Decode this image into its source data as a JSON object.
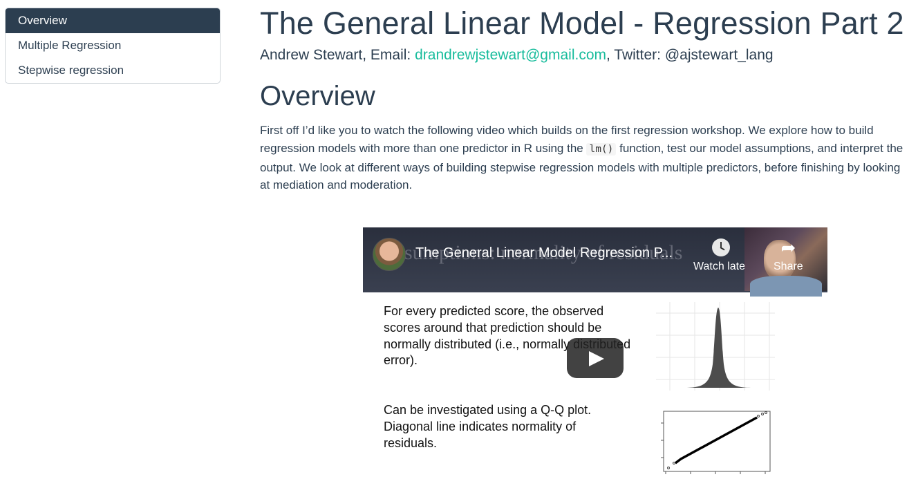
{
  "toc": {
    "items": [
      {
        "label": "Overview",
        "active": true
      },
      {
        "label": "Multiple Regression",
        "active": false
      },
      {
        "label": "Stepwise regression",
        "active": false
      }
    ]
  },
  "header": {
    "title": "The General Linear Model - Regression Part 2",
    "author_prefix": "Andrew Stewart, Email: ",
    "email": "drandrewjstewart@gmail.com",
    "author_suffix": ", Twitter: @ajstewart_lang"
  },
  "overview": {
    "heading": "Overview",
    "text_1": "First off I’d like you to watch the following video which builds on the first regression workshop. We explore how to build regression models with more than one predictor in R using the ",
    "code": "lm()",
    "text_2": " function, test our model assumptions, and interpret the output. We look at different ways of building stepwise regression models with multiple predictors, before finishing by looking at mediation and moderation."
  },
  "video": {
    "title": "The General Linear Model Regression P...",
    "background_title": "sumptions: normality of residuals",
    "watch_later_label": "Watch later",
    "share_label": "Share",
    "slide_text_1": "For every predicted score, the observed scores around that prediction should be normally distributed (i.e., normally distributed error).",
    "slide_text_2": "Can be investigated using a Q-Q plot. Diagonal line indicates normality of residuals."
  },
  "colors": {
    "navy": "#2c3e50",
    "link": "#18bc9c"
  }
}
